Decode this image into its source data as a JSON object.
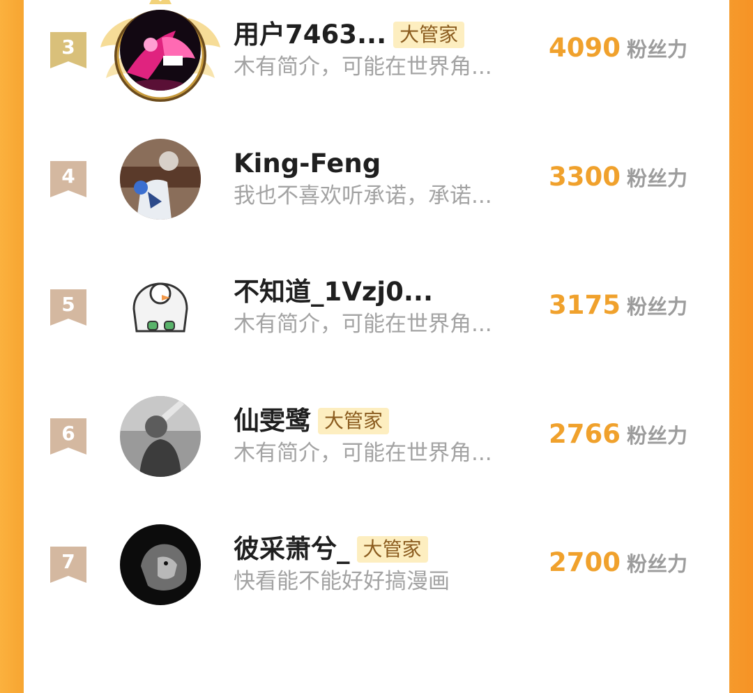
{
  "colors": {
    "score": "#f0a12c",
    "badge_bg": "#fdeec0",
    "badge_text": "#8b5c1f",
    "rank_gold": "#d9c07a",
    "rank_tan": "#d4b8a0",
    "side_orange": "#f7a531"
  },
  "list": [
    {
      "rank": "3",
      "avatar": "dark-pink-character-avatar",
      "name": "用户7463...",
      "badge": "大管家",
      "intro": "木有简介，可能在世界角...",
      "score": "4090",
      "unit": "粉丝力"
    },
    {
      "rank": "4",
      "avatar": "person-photo-avatar",
      "name": "King-Feng",
      "badge": "",
      "intro": "我也不喜欢听承诺，承诺...",
      "score": "3300",
      "unit": "粉丝力"
    },
    {
      "rank": "5",
      "avatar": "duck-cartoon-avatar",
      "name": "不知道_1Vzj0...",
      "badge": "",
      "intro": "木有简介，可能在世界角...",
      "score": "3175",
      "unit": "粉丝力"
    },
    {
      "rank": "6",
      "avatar": "grayscale-person-avatar",
      "name": "仙雯鹭",
      "badge": "大管家",
      "intro": "木有简介，可能在世界角...",
      "score": "2766",
      "unit": "粉丝力"
    },
    {
      "rank": "7",
      "avatar": "lion-avatar",
      "name": "彼采萧兮_",
      "badge": "大管家",
      "intro": "快看能不能好好搞漫画",
      "score": "2700",
      "unit": "粉丝力"
    }
  ]
}
